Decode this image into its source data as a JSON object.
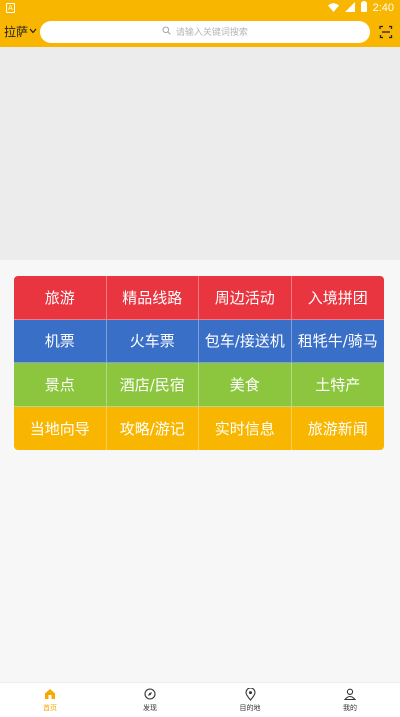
{
  "status_bar": {
    "time": "2:40",
    "sim_label": "A"
  },
  "header": {
    "city": "拉萨",
    "search_placeholder": "请输入关键词搜索"
  },
  "menu": [
    {
      "label": "旅游",
      "color": "#e8353f"
    },
    {
      "label": "精品线路",
      "color": "#e8353f"
    },
    {
      "label": "周边活动",
      "color": "#e8353f"
    },
    {
      "label": "入境拼团",
      "color": "#e8353f"
    },
    {
      "label": "机票",
      "color": "#3a6fc7"
    },
    {
      "label": "火车票",
      "color": "#3a6fc7"
    },
    {
      "label": "包车/接送机",
      "color": "#3a6fc7"
    },
    {
      "label": "租牦牛/骑马",
      "color": "#3a6fc7"
    },
    {
      "label": "景点",
      "color": "#8cc63f"
    },
    {
      "label": "酒店/民宿",
      "color": "#8cc63f"
    },
    {
      "label": "美食",
      "color": "#8cc63f"
    },
    {
      "label": "土特产",
      "color": "#8cc63f"
    },
    {
      "label": "当地向导",
      "color": "#f8b600"
    },
    {
      "label": "攻略/游记",
      "color": "#f8b600"
    },
    {
      "label": "实时信息",
      "color": "#f8b600"
    },
    {
      "label": "旅游新闻",
      "color": "#f8b600"
    }
  ],
  "tabs": [
    {
      "label": "首页",
      "icon": "home-icon",
      "active": true
    },
    {
      "label": "发现",
      "icon": "compass-icon",
      "active": false
    },
    {
      "label": "目的地",
      "icon": "location-pin-icon",
      "active": false
    },
    {
      "label": "我的",
      "icon": "user-icon",
      "active": false
    }
  ],
  "colors": {
    "accent": "#f8b600"
  }
}
